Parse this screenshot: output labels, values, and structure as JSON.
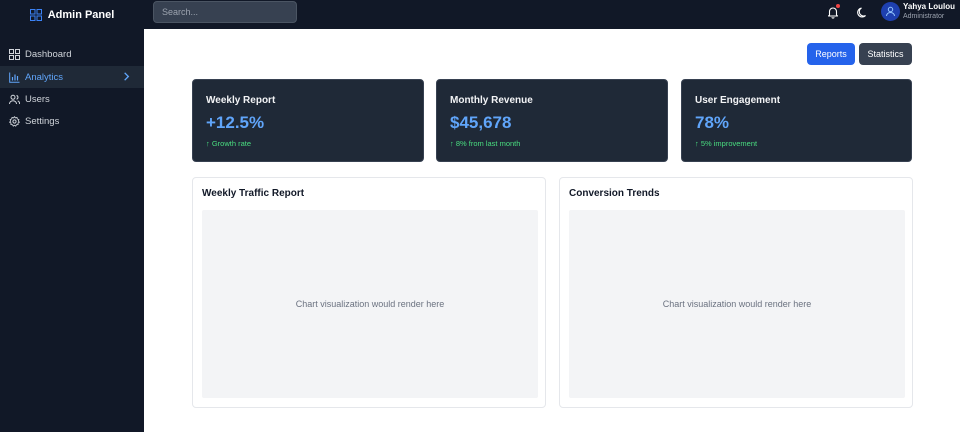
{
  "app": {
    "title": "Admin Panel"
  },
  "search": {
    "placeholder": "Search..."
  },
  "user": {
    "name": "Yahya Loulou",
    "role": "Administrator"
  },
  "sidebar": {
    "items": [
      {
        "label": "Dashboard",
        "icon": "dashboard-icon",
        "active": false
      },
      {
        "label": "Analytics",
        "icon": "analytics-icon",
        "active": true
      },
      {
        "label": "Users",
        "icon": "users-icon",
        "active": false
      },
      {
        "label": "Settings",
        "icon": "gear-icon",
        "active": false
      }
    ]
  },
  "toolbar": {
    "reports_label": "Reports",
    "statistics_label": "Statistics"
  },
  "cards": [
    {
      "title": "Weekly Report",
      "value": "+12.5%",
      "sub": "↑ Growth rate"
    },
    {
      "title": "Monthly Revenue",
      "value": "$45,678",
      "sub": "↑ 8% from last month"
    },
    {
      "title": "User Engagement",
      "value": "78%",
      "sub": "↑ 5% improvement"
    }
  ],
  "panels": [
    {
      "title": "Weekly Traffic Report",
      "placeholder": "Chart visualization would render here"
    },
    {
      "title": "Conversion Trends",
      "placeholder": "Chart visualization would render here"
    }
  ],
  "colors": {
    "sidebar_bg": "#111827",
    "card_bg": "#1f2937",
    "accent": "#2563eb",
    "value": "#60a5fa",
    "positive": "#4ade80",
    "notification": "#ef4444"
  }
}
